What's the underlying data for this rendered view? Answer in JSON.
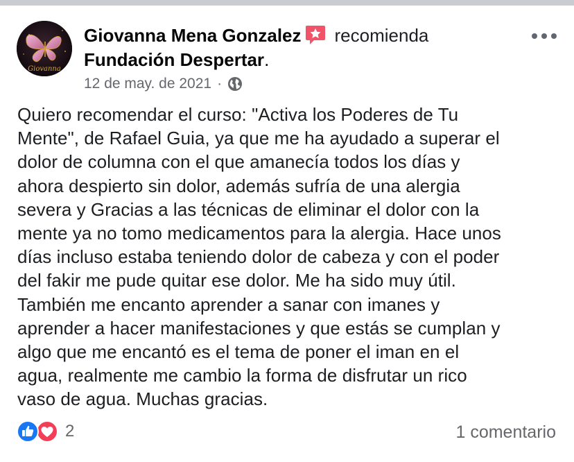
{
  "post": {
    "author": "Giovanna Mena Gonzalez",
    "action": "recomienda",
    "page_name": "Fundación Despertar",
    "page_suffix": ".",
    "date": "12 de may. de 2021",
    "meta_separator": "·",
    "privacy_icon": "globe-icon",
    "badge_icon": "recommend-star-icon",
    "avatar_signature": "Giovanna",
    "text_lines": [
      "Quiero recomendar el curso: \"Activa los Poderes de Tu",
      "Mente\", de Rafael Guia, ya que me ha ayudado a superar el",
      "dolor de columna con el que amanecía todos los días y",
      "ahora despierto sin dolor, además sufría de una alergia",
      "severa y Gracias a las técnicas de eliminar el dolor con la",
      "mente ya no tomo medicamentos para la alergia. Hace unos",
      "días incluso estaba teniendo dolor de cabeza y con el poder",
      "del fakir me pude quitar ese dolor. Me ha sido muy útil.",
      "También me encanto aprender a sanar con imanes y",
      "aprender a hacer manifestaciones y que estás se cumplan y",
      "algo que me encantó es el tema de poner el iman en el",
      "agua, realmente me cambio la forma de disfrutar un rico",
      "vaso de agua. Muchas gracias."
    ]
  },
  "footer": {
    "reaction_count": "2",
    "comments": "1 comentario",
    "reaction_icons": [
      "like-icon",
      "love-icon"
    ]
  },
  "colors": {
    "like_blue": "#1877f2",
    "love_red": "#f33e58",
    "badge_pink": "#f35369",
    "secondary_text": "#65676b"
  }
}
